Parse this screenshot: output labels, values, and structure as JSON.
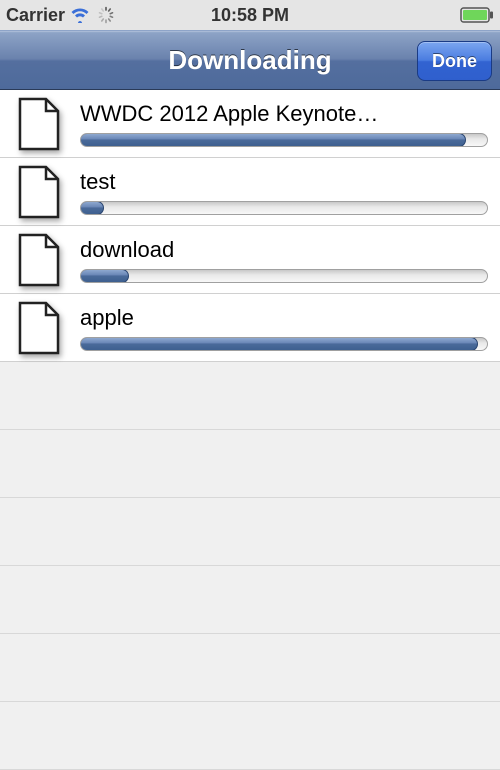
{
  "status_bar": {
    "carrier": "Carrier",
    "time": "10:58 PM"
  },
  "nav": {
    "title": "Downloading",
    "done_label": "Done"
  },
  "downloads": [
    {
      "title": "WWDC 2012 Apple Keynote…",
      "progress": 95
    },
    {
      "title": "test",
      "progress": 6
    },
    {
      "title": "download",
      "progress": 12
    },
    {
      "title": "apple",
      "progress": 98
    }
  ],
  "colors": {
    "nav_start": "#8da3c6",
    "nav_end": "#4e6a9b",
    "progress_fill": "#4a6a9a",
    "done_button": "#3263d1"
  }
}
